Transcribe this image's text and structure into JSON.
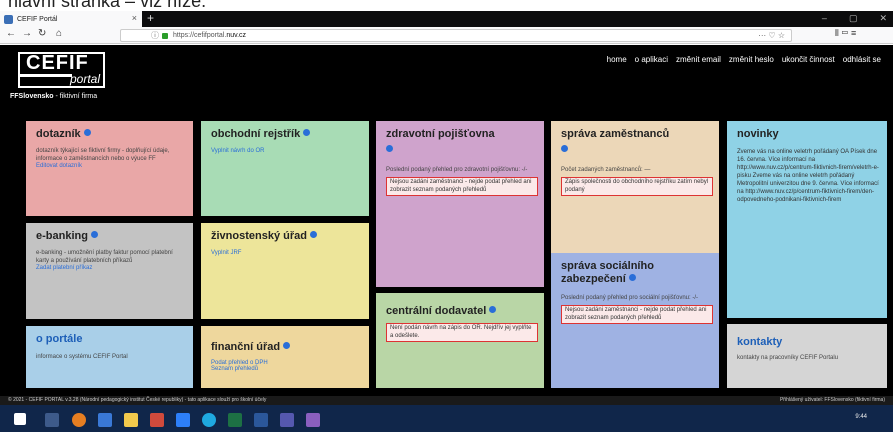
{
  "caption": "hlavní stránka – viz níže.",
  "browser": {
    "tab_title": "CEFIF Portál",
    "tab_close": "×",
    "new_tab": "+",
    "url_host": "https://cefifportal.",
    "url_domain": "nuv.cz",
    "url_info": "ⓘ",
    "url_right": "··· ♡ ☆",
    "toolbar_right": "⫴ ▭ ≡",
    "win_min": "–",
    "win_max": "▢",
    "win_close": "✕"
  },
  "logo": {
    "main": "CEFIF",
    "sub": "portal"
  },
  "menu": [
    "home",
    "o aplikaci",
    "změnit email",
    "změnit heslo",
    "ukončit činnost",
    "odhlásit se"
  ],
  "firm": {
    "name": "FFSlovensko",
    "suffix": " - fiktivní firma"
  },
  "tiles": {
    "dotaznik": {
      "title": "dotazník",
      "desc": "dotazník týkající se fiktivní firmy - doplňující údaje, informace o zaměstnancích nebo o výuce FF",
      "link": "Editovat dotazník"
    },
    "rejstrik": {
      "title": "obchodní rejstřík",
      "link": "Vyplnit návrh do OR"
    },
    "zdravotni": {
      "title": "zdravotní pojišťovna",
      "desc": "Poslední podaný přehled pro zdravotní pojišťovnu: -/-",
      "warn": "Nejsou zadáni zaměstnanci - nejde podat přehled ani zobrazit seznam podaných přehledů"
    },
    "zamestnanci": {
      "title": "správa zaměstnanců",
      "desc": "Počet zadaných zaměstnanců: —",
      "warn": "Zápis společnosti do obchodního rejstříku zatím nebyl podaný"
    },
    "novinky": {
      "title": "novinky",
      "desc": "Zveme vás na online veletrh pořádaný OA Písek dne 16. června. Více informací na http://www.nuv.cz/p/centrum-fiktivnich-firem/veletrh-e-pisku Zveme vás na online veletrh pořádaný Metropolitní univerzitou dne 9. června. Více informací na http://www.nuv.cz/p/centrum-fiktivnich-firem/den-odpovedneho-podnikani-fiktivnich-firem"
    },
    "ebanking": {
      "title": "e-banking",
      "desc": "e-banking - umožnění platby faktur pomocí platební karty a používání platebních příkazů",
      "link": "Zadat platební příkaz"
    },
    "zivnost": {
      "title": "živnostenský úřad",
      "link": "Vyplnit JRF"
    },
    "socialni": {
      "title": "správa sociálního zabezpečení",
      "desc": "Poslední podaný přehled pro sociální pojišťovnu: -/-",
      "warn": "Nejsou zadáni zaměstnanci - nejde podat přehled ani zobrazit seznam podaných přehledů"
    },
    "dodavatel": {
      "title": "centrální dodavatel",
      "warn": "Není podán návrh na zápis do OR. Nejdřív jej vyplňte a odešlete."
    },
    "portale": {
      "title": "o portále",
      "desc": "informace o systému CEFIF Portal"
    },
    "financni": {
      "title": "finanční úřad",
      "link1": "Podat přehled o DPH",
      "link2": "Seznam přehledů"
    },
    "kontakty": {
      "title": "kontakty",
      "desc": "kontakty na pracovníky CEFIF Portalu"
    }
  },
  "footer": {
    "left": "© 2021 - CEFIF PORTAL v.3.28 (Národní pedagogický institut České republiky) - tato aplikace slouží pro školní účely",
    "right": "Přihlášený uživatel: FFSlovensko (fiktivní firma)"
  },
  "taskbar": {
    "time": "9:44"
  },
  "colors": {
    "dotaznik": "#e9a7a7",
    "rejstrik": "#a8dcb5",
    "zdravotni": "#cfa3cc",
    "zamestnanci": "#ecd7b8",
    "novinky": "#8fd2e6",
    "ebanking": "#c3c3c3",
    "zivnost": "#ede59a",
    "socialni": "#9fb2e3",
    "dodavatel": "#b9d6a6",
    "portale": "#a9cfe8",
    "financni": "#eed79d",
    "kontakty": "#d5d5d5"
  }
}
